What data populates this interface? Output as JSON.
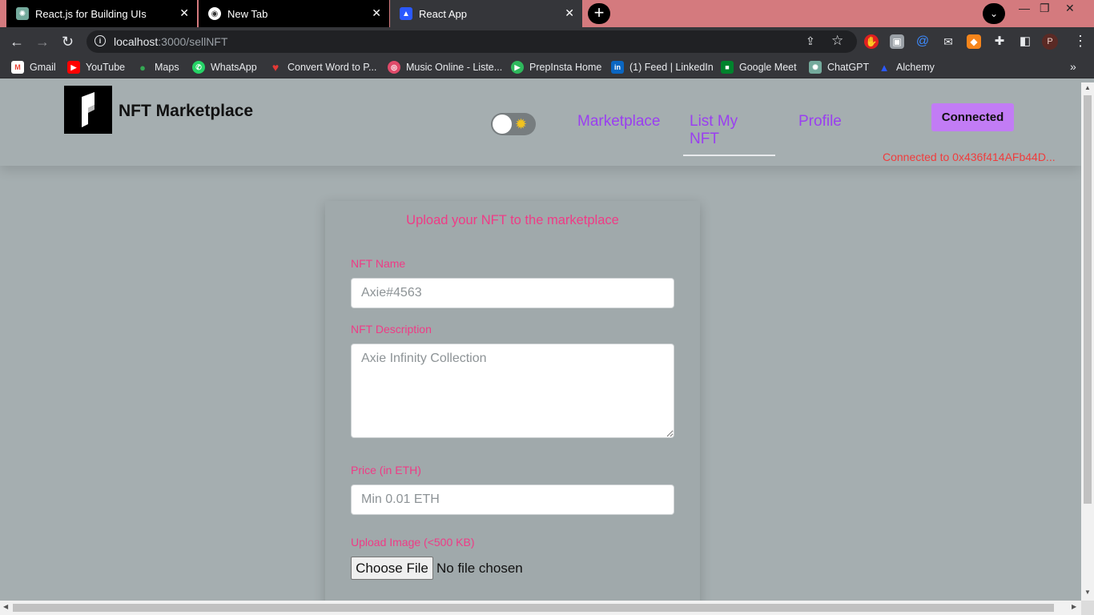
{
  "browser": {
    "tabs": [
      {
        "title": "React.js for Building UIs",
        "icon": "chatgpt-icon"
      },
      {
        "title": "New Tab",
        "icon": "chrome-icon"
      },
      {
        "title": "React App",
        "icon": "alchemy-icon"
      }
    ],
    "new_tab_symbol": "+",
    "address": {
      "host": "localhost",
      "path": ":3000/sellNFT"
    },
    "bookmarks": [
      {
        "label": "Gmail",
        "icon": "gmail-icon",
        "color": "#ea4335",
        "glyph": "M"
      },
      {
        "label": "YouTube",
        "icon": "youtube-icon",
        "color": "#ff0000",
        "glyph": "▶"
      },
      {
        "label": "Maps",
        "icon": "maps-icon",
        "color": "#34a853",
        "glyph": "●"
      },
      {
        "label": "WhatsApp",
        "icon": "whatsapp-icon",
        "color": "#25d366",
        "glyph": "✆"
      },
      {
        "label": "Convert Word to P...",
        "icon": "heart-icon",
        "color": "#e53935",
        "glyph": "♥"
      },
      {
        "label": "Music Online - Liste...",
        "icon": "music-icon",
        "color": "#e04a6a",
        "glyph": "◎"
      },
      {
        "label": "PrepInsta Home",
        "icon": "prepinsta-icon",
        "color": "#2eb85c",
        "glyph": "▶"
      },
      {
        "label": "(1) Feed | LinkedIn",
        "icon": "linkedin-icon",
        "color": "#0a66c2",
        "glyph": "in"
      },
      {
        "label": "Google Meet",
        "icon": "google-meet-icon",
        "color": "#00832d",
        "glyph": "■"
      },
      {
        "label": "ChatGPT",
        "icon": "chatgpt-icon",
        "color": "#74aa9c",
        "glyph": "✺"
      },
      {
        "label": "Alchemy",
        "icon": "alchemy-icon",
        "color": "#2b59ff",
        "glyph": "▲"
      }
    ],
    "more_bookmarks": "»"
  },
  "app": {
    "brand": "NFT Marketplace",
    "nav": {
      "marketplace": "Marketplace",
      "list_my_nft": "List My NFT",
      "profile": "Profile"
    },
    "connect_button": "Connected",
    "connected_to": "Connected to 0x436f414AFb44D...",
    "theme_toggle": {
      "state": "light",
      "icon": "sun-icon"
    },
    "colors": {
      "accent": "#9a3ff0",
      "form_label": "#ef3b86",
      "connect_button": "#c27cf5",
      "status": "#f03c3c"
    }
  },
  "form": {
    "title": "Upload your NFT to the marketplace",
    "name_label": "NFT Name",
    "name_placeholder": "Axie#4563",
    "description_label": "NFT Description",
    "description_placeholder": "Axie Infinity Collection",
    "price_label": "Price (in ETH)",
    "price_placeholder": "Min 0.01 ETH",
    "image_label": "Upload Image (<500 KB)",
    "file_button": "Choose File",
    "file_status": "No file chosen"
  }
}
